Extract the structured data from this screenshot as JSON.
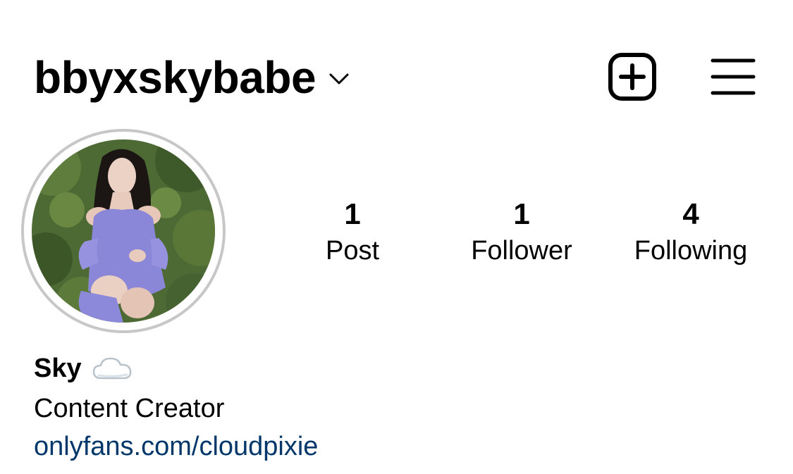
{
  "header": {
    "username": "bbyxskybabe",
    "icons": {
      "account_switcher": "chevron-down-icon",
      "new_post": "plus-square-icon",
      "menu": "hamburger-menu-icon"
    }
  },
  "profile": {
    "avatar": "profile-photo",
    "stats": {
      "posts": {
        "count": "1",
        "label": "Post"
      },
      "followers": {
        "count": "1",
        "label": "Follower"
      },
      "following": {
        "count": "4",
        "label": "Following"
      }
    },
    "name": "Sky",
    "name_emoji": "cloud-icon",
    "bio": "Content Creator",
    "link": "onlyfans.com/cloudpixie"
  },
  "colors": {
    "link": "#00376b",
    "avatar_ring": "#c7c7c7",
    "text": "#000000"
  }
}
